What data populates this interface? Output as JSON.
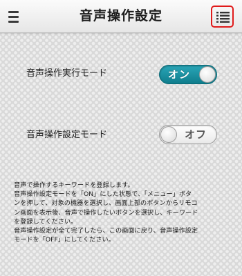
{
  "header": {
    "title": "音声操作設定",
    "menu_icon": "hamburger-menu-icon",
    "list_icon": "list-icon",
    "list_button_border_color": "#e01a1a"
  },
  "settings": [
    {
      "label": "音声操作実行モード",
      "toggle_label": "オン",
      "state": "on"
    },
    {
      "label": "音声操作設定モード",
      "toggle_label": "オフ",
      "state": "off"
    }
  ],
  "colors": {
    "toggle_on": "#1a93a5",
    "toggle_off": "#f2f2f2"
  },
  "description": {
    "lines": [
      "音声で操作するキーワードを登録します。",
      "音声操作設定モードを「ON」にした状態で、「メニュー」ボタ",
      "ンを押して、対象の機器を選択し、画面上部のボタンからリモコ",
      "ン画面を表示後、音声で操作したいボタンを選択し、キーワード",
      "を登録してください。",
      "音声操作設定が全て完了したら、この画面に戻り、音声操作設定",
      "モードを「OFF」にしてください。"
    ]
  }
}
